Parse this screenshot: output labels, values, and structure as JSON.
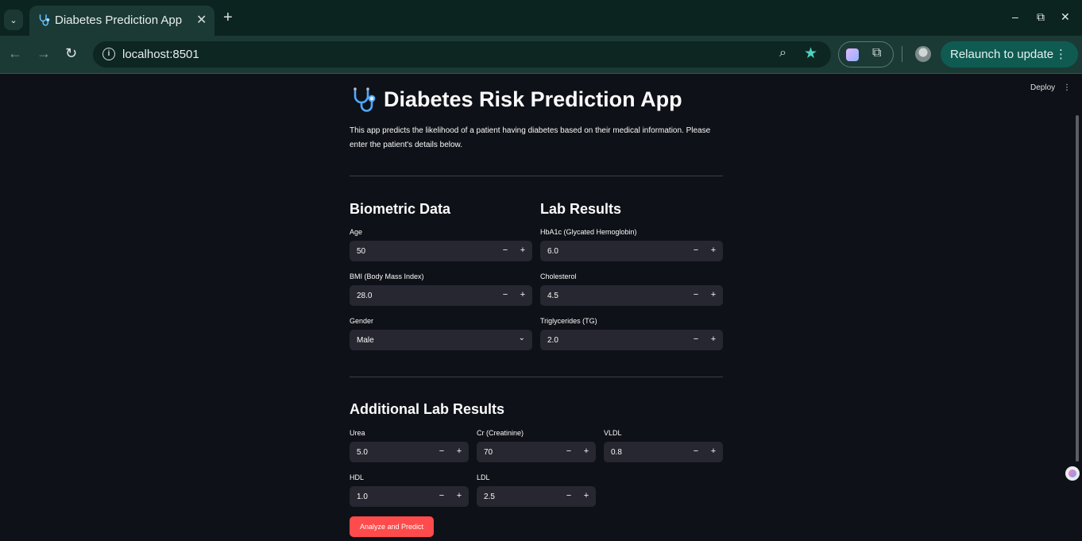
{
  "browser": {
    "tab_title": "Diabetes Prediction App",
    "tab_close": "✕",
    "new_tab": "+",
    "url": "localhost:8501",
    "relaunch_label": "Relaunch to update",
    "window": {
      "minimize": "–",
      "restore": "⧉",
      "close": "✕"
    }
  },
  "app": {
    "deploy_label": "Deploy",
    "title": "Diabetes Risk Prediction App",
    "intro_line1": "This app predicts the likelihood of a patient having diabetes based on their medical information. Please",
    "intro_line2": "enter the patient's details below.",
    "biometric": {
      "heading": "Biometric Data",
      "age_label": "Age",
      "age_value": "50",
      "bmi_label": "BMI (Body Mass Index)",
      "bmi_value": "28.0",
      "gender_label": "Gender",
      "gender_value": "Male"
    },
    "lab": {
      "heading": "Lab Results",
      "hba1c_label": "HbA1c (Glycated Hemoglobin)",
      "hba1c_value": "6.0",
      "chol_label": "Cholesterol",
      "chol_value": "4.5",
      "tg_label": "Triglycerides (TG)",
      "tg_value": "2.0"
    },
    "additional": {
      "heading": "Additional Lab Results",
      "urea_label": "Urea",
      "urea_value": "5.0",
      "cr_label": "Cr (Creatinine)",
      "cr_value": "70",
      "vldl_label": "VLDL",
      "vldl_value": "0.8",
      "hdl_label": "HDL",
      "hdl_value": "1.0",
      "ldl_label": "LDL",
      "ldl_value": "2.5"
    },
    "stepper": {
      "minus": "−",
      "plus": "+"
    },
    "predict_label": "Analyze and Predict"
  },
  "colors": {
    "app_bg": "#0e1117",
    "input_bg": "#262730",
    "primary_button": "#ff4b4b",
    "browser_frame": "#1b3a35"
  },
  "icons": {
    "title_icon": "stethoscope-icon",
    "url_icon": "site-info-icon"
  }
}
